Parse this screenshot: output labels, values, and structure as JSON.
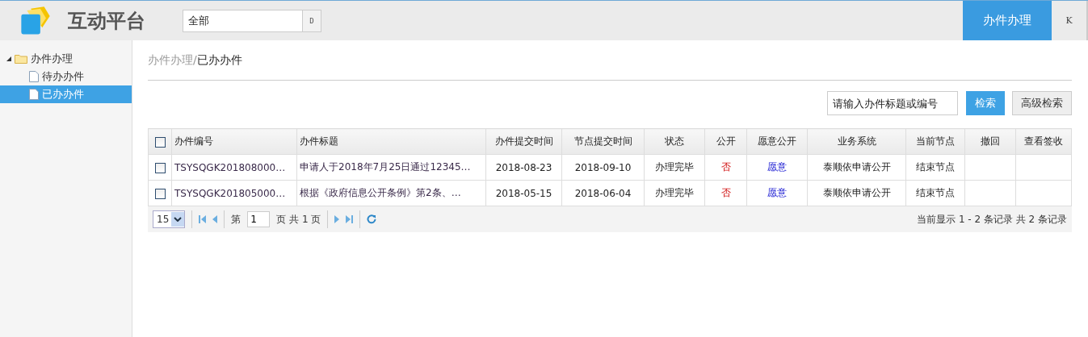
{
  "header": {
    "title": "互动平台",
    "scope_select": {
      "value": "全部",
      "button": "D"
    },
    "nav_tabs": [
      {
        "label": "办件办理",
        "selected": true
      }
    ],
    "extra_button": "K"
  },
  "sidebar": {
    "tree": [
      {
        "label": "办件办理",
        "expanded": true,
        "selected": false,
        "children": [
          {
            "label": "待办办件",
            "selected": false
          },
          {
            "label": "已办办件",
            "selected": true
          }
        ]
      }
    ]
  },
  "breadcrumb": {
    "parent": "办件办理/",
    "current": "已办办件"
  },
  "search": {
    "placeholder": "请输入办件标题或编号",
    "buttons": [
      {
        "label": "检索",
        "kind": "primary"
      },
      {
        "label": "高级检索",
        "kind": "plain"
      }
    ]
  },
  "table": {
    "all_checked": false,
    "columns": [
      {
        "label": "办件编号",
        "kind": "text"
      },
      {
        "label": "办件标题",
        "kind": "text"
      },
      {
        "label": "办件提交时间",
        "kind": "center"
      },
      {
        "label": "节点提交时间",
        "kind": "center"
      },
      {
        "label": "状态",
        "kind": "center"
      },
      {
        "label": "公开",
        "kind": "no"
      },
      {
        "label": "愿意公开",
        "kind": "yes"
      },
      {
        "label": "业务系统",
        "kind": "center"
      },
      {
        "label": "当前节点",
        "kind": "center"
      },
      {
        "label": "撤回",
        "kind": "center"
      },
      {
        "label": "查看签收",
        "kind": "center"
      }
    ],
    "rows": [
      {
        "checked": false,
        "cells": [
          "TSYSQGK201808000…",
          "申请人于2018年7月25日通过12345…",
          "2018-08-23",
          "2018-09-10",
          "办理完毕",
          "否",
          "愿意",
          "泰顺依申请公开",
          "结束节点",
          "",
          ""
        ]
      },
      {
        "checked": false,
        "cells": [
          "TSYSQGK201805000…",
          "根据《政府信息公开条例》第2条、…",
          "2018-05-15",
          "2018-06-04",
          "办理完毕",
          "否",
          "愿意",
          "泰顺依申请公开",
          "结束节点",
          "",
          ""
        ]
      }
    ]
  },
  "pager": {
    "page_size": "15",
    "page_label": "第",
    "page": "1",
    "page_total": "页 共 1 页",
    "summary": "当前显示 1 - 2 条记录 共 2 条记录"
  }
}
